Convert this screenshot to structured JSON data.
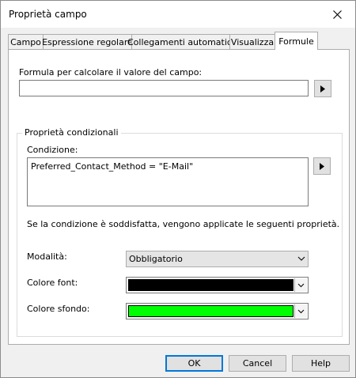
{
  "window": {
    "title": "Proprietà campo"
  },
  "tabs": [
    {
      "label": "Campo"
    },
    {
      "label": "Espressione regolare"
    },
    {
      "label": "Collegamenti automatici"
    },
    {
      "label": "Visualizza"
    },
    {
      "label": "Formule",
      "active": true
    }
  ],
  "formula": {
    "label": "Formula per calcolare il valore del campo:",
    "value": ""
  },
  "conditional": {
    "group_title": "Proprietà condizionali",
    "condition_label": "Condizione:",
    "condition_value": "Preferred_Contact_Method = \"E-Mail\"",
    "info_text": "Se la condizione è soddisfatta, vengono applicate le seguenti proprietà.",
    "mode_label": "Modalità:",
    "mode_value": "Obbligatorio",
    "font_color_label": "Colore font:",
    "font_color": "#000000",
    "bg_color_label": "Colore sfondo:",
    "bg_color": "#00ff00"
  },
  "buttons": {
    "ok": "OK",
    "cancel": "Cancel",
    "help": "Help"
  }
}
